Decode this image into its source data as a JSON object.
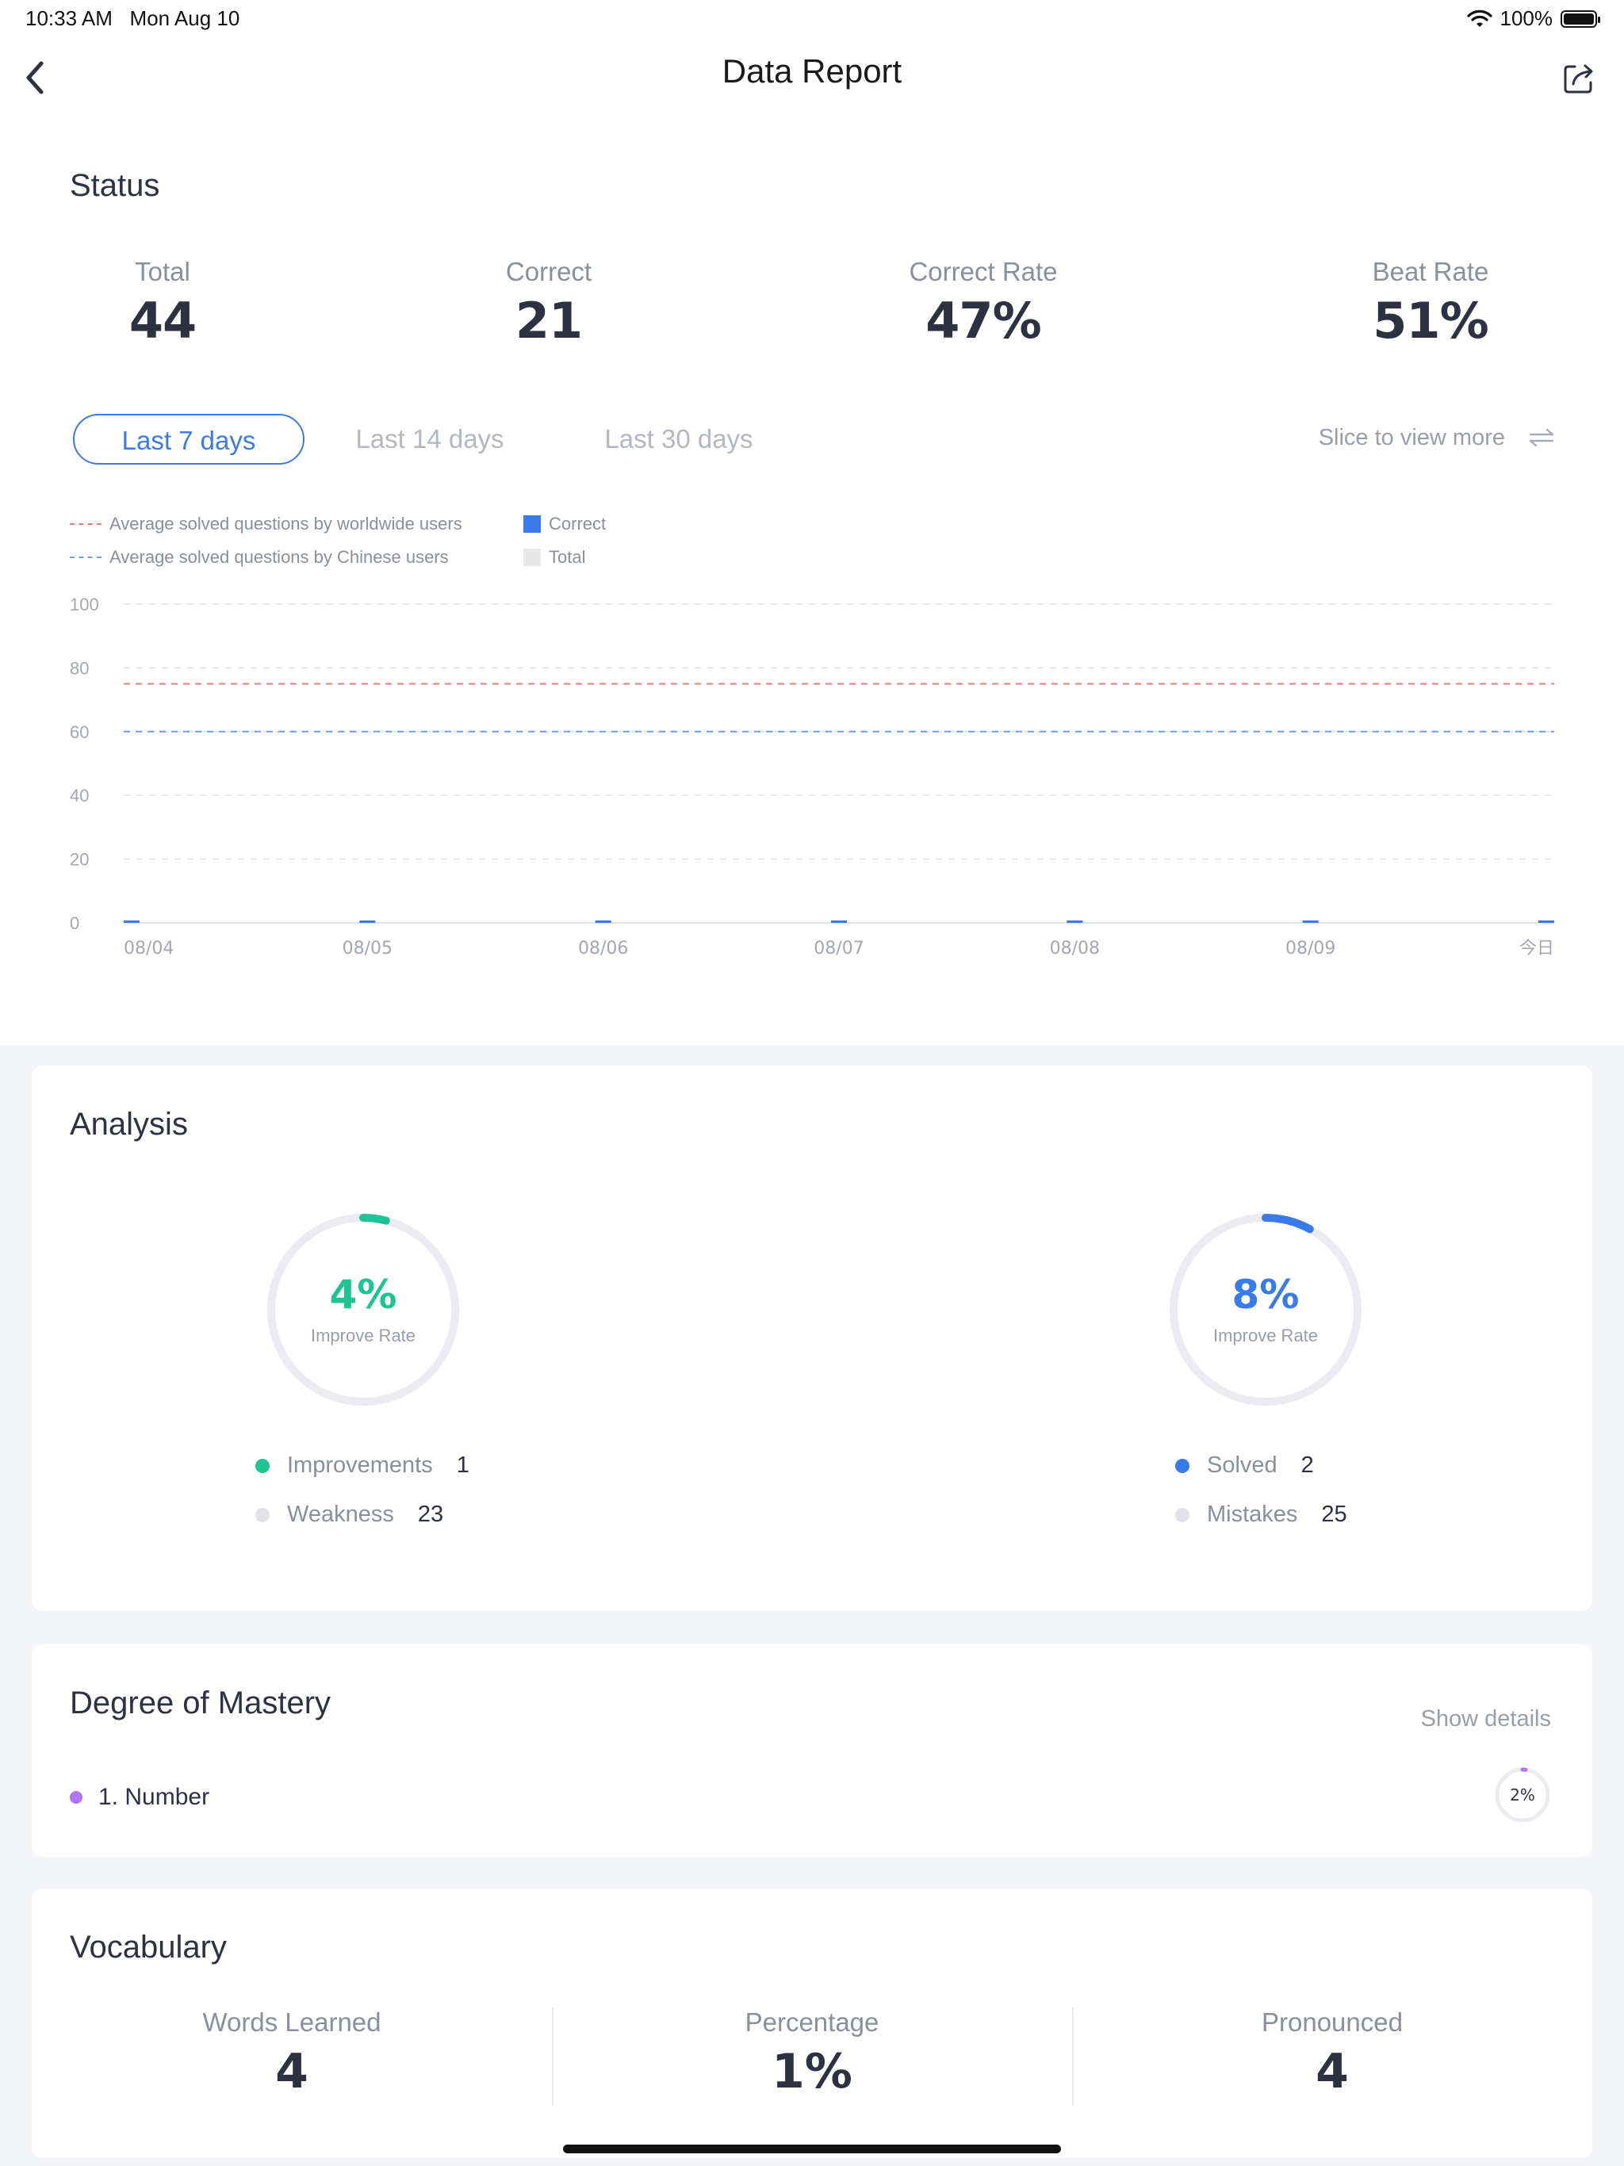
{
  "status_bar": {
    "time": "10:33 AM",
    "date": "Mon Aug 10",
    "battery": "100%"
  },
  "nav": {
    "title": "Data Report",
    "back_icon": "chevron-left-icon",
    "share_icon": "share-icon"
  },
  "status": {
    "title": "Status",
    "stats": [
      {
        "label": "Total",
        "value": "44"
      },
      {
        "label": "Correct",
        "value": "21"
      },
      {
        "label": "Correct Rate",
        "value": "47%"
      },
      {
        "label": "Beat Rate",
        "value": "51%"
      }
    ],
    "tabs": [
      "Last 7 days",
      "Last 14 days",
      "Last 30 days"
    ],
    "active_tab": "Last 7 days",
    "slice_more": "Slice to view more"
  },
  "chart_data": {
    "type": "bar",
    "legend": {
      "worldwide": "Average solved questions by worldwide users",
      "chinese": "Average solved questions by Chinese users",
      "correct": "Correct",
      "total": "Total"
    },
    "categories": [
      "08/04",
      "08/05",
      "08/06",
      "08/07",
      "08/08",
      "08/09",
      "今日"
    ],
    "series": [
      {
        "name": "Correct",
        "values": [
          0,
          0,
          0,
          0,
          0,
          0,
          0
        ],
        "color": "#3a7bea"
      },
      {
        "name": "Total",
        "values": [
          0,
          0,
          0,
          0,
          0,
          0,
          0
        ],
        "color": "#e8e8e8"
      }
    ],
    "reference_lines": [
      {
        "name": "Average solved questions by worldwide users",
        "value": 75,
        "color": "#ee7b7b"
      },
      {
        "name": "Average solved questions by Chinese users",
        "value": 60,
        "color": "#6a9cf0"
      }
    ],
    "yticks": [
      "100",
      "80",
      "60",
      "40",
      "20",
      "0"
    ],
    "ylim": [
      0,
      100
    ],
    "grid": true
  },
  "analysis": {
    "title": "Analysis",
    "left": {
      "percent": "4%",
      "percent_value": 4,
      "caption": "Improve Rate",
      "color": "#1fc494",
      "items": [
        {
          "label": "Improvements",
          "value": "1",
          "color": "#1fc494"
        },
        {
          "label": "Weakness",
          "value": "23",
          "color": "#e2e3e8"
        }
      ]
    },
    "right": {
      "percent": "8%",
      "percent_value": 8,
      "caption": "Improve Rate",
      "color": "#3a7bea",
      "items": [
        {
          "label": "Solved",
          "value": "2",
          "color": "#3a7bea"
        },
        {
          "label": "Mistakes",
          "value": "25",
          "color": "#e2e3e8"
        }
      ]
    }
  },
  "mastery": {
    "title": "Degree of Mastery",
    "show_details": "Show details",
    "items": [
      {
        "label": "1. Number",
        "percent": "2%",
        "percent_value": 2,
        "color": "#b075f0"
      }
    ]
  },
  "vocabulary": {
    "title": "Vocabulary",
    "stats": [
      {
        "label": "Words Learned",
        "value": "4"
      },
      {
        "label": "Percentage",
        "value": "1%"
      },
      {
        "label": "Pronounced",
        "value": "4"
      }
    ]
  }
}
